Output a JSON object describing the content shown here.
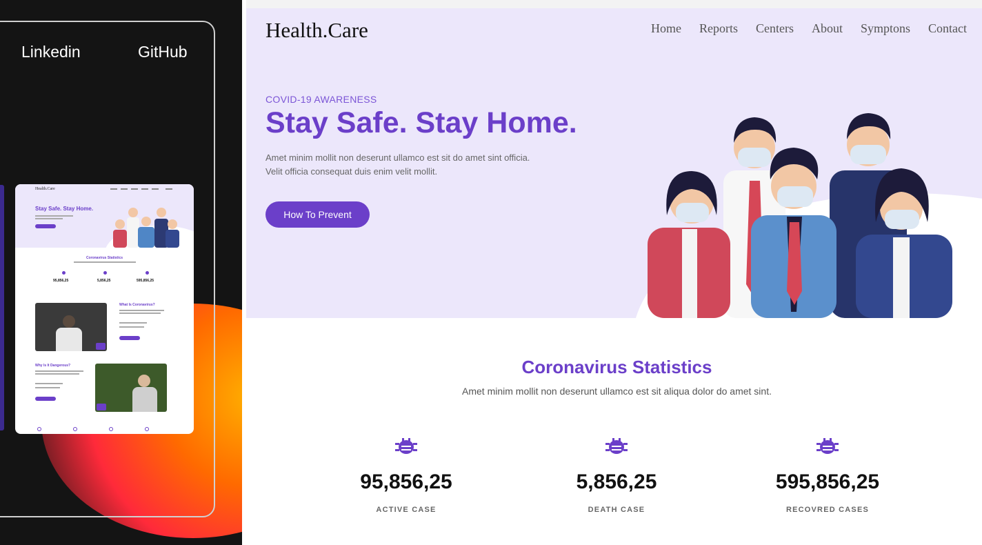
{
  "side_panel": {
    "links": {
      "linkedin": "Linkedin",
      "github": "GitHub"
    }
  },
  "thumbnail": {
    "brand": "Health.Care",
    "hero_title": "Stay Safe. Stay Home.",
    "stats_title": "Coronavirus  Statistics",
    "stats": [
      "95,856,25",
      "5,856,25",
      "595,856,25"
    ],
    "section1_title": "What Is Coronavirus?",
    "section2_title": "Why Is It Dangerous?"
  },
  "site": {
    "brand": "Health.Care",
    "nav": [
      "Home",
      "Reports",
      "Centers",
      "About",
      "Symptons",
      "Contact"
    ],
    "hero": {
      "eyebrow": "COVID-19 AWARENESS",
      "headline": "Stay Safe. Stay Home.",
      "lede_line1": "Amet minim mollit non deserunt ullamco est sit do amet sint officia.",
      "lede_line2": "Velit officia consequat duis enim velit mollit.",
      "cta_label": "How To Prevent"
    },
    "statistics": {
      "title": "Coronavirus  Statistics",
      "subtitle": "Amet minim mollit non deserunt ullamco est sit aliqua dolor do amet sint.",
      "items": [
        {
          "value": "95,856,25",
          "label": "ACTIVE CASE",
          "icon": "virus-icon"
        },
        {
          "value": "5,856,25",
          "label": "DEATH CASE",
          "icon": "virus-icon"
        },
        {
          "value": "595,856,25",
          "label": "RECOVRED CASES",
          "icon": "virus-icon"
        }
      ]
    }
  },
  "colors": {
    "brand_purple": "#6b3fc9",
    "hero_bg": "#ece7fb",
    "dark_panel": "#141414",
    "glow_orange": "#ff6a00"
  }
}
